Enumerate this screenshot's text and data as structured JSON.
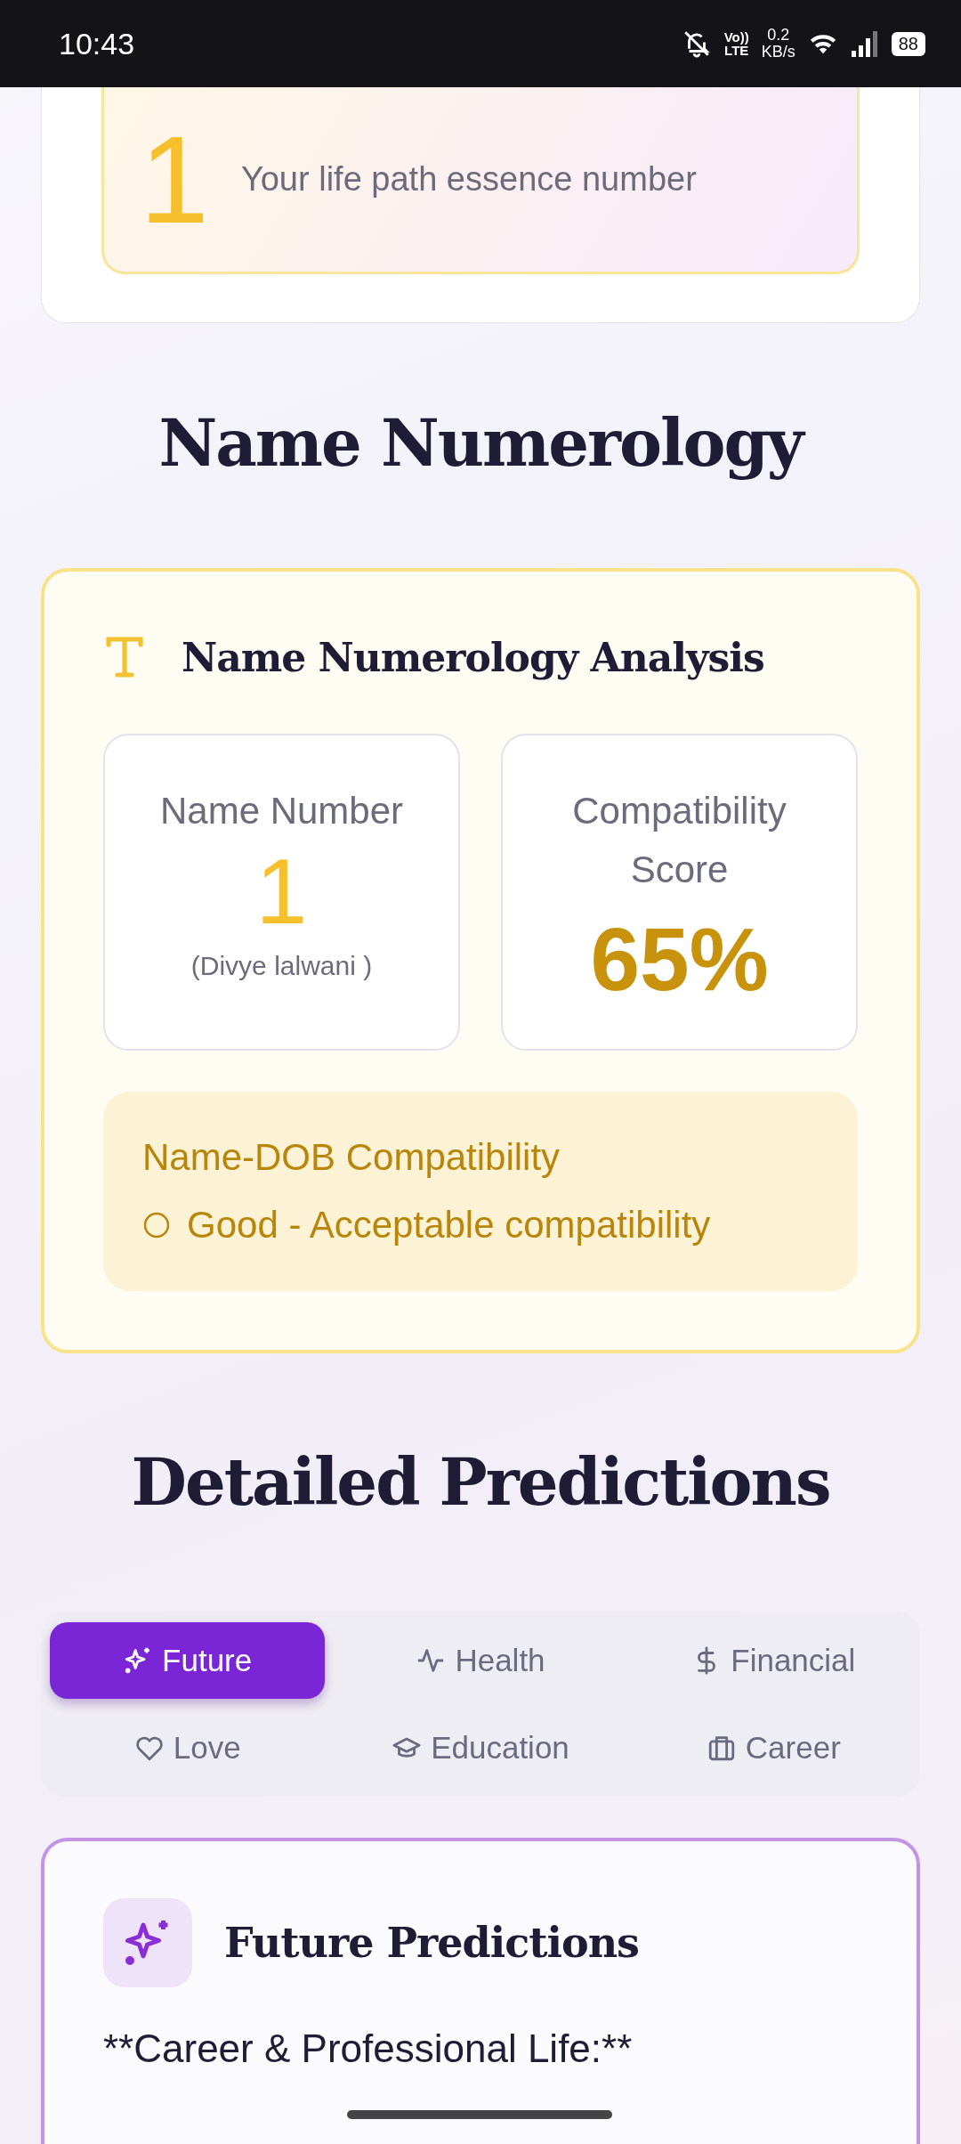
{
  "status_bar": {
    "time": "10:43",
    "network_speed": "0.2",
    "network_unit": "KB/s",
    "volte": "Vo))",
    "lte": "LTE",
    "battery": "88"
  },
  "essence_card": {
    "number": "1",
    "label": "Your life path essence number"
  },
  "name_section": {
    "heading": "Name Numerology",
    "card_title": "Name Numerology Analysis",
    "name_number": {
      "label": "Name Number",
      "value": "1",
      "name": "(Divye lalwani )"
    },
    "compatibility": {
      "label": "Compatibility Score",
      "value": "65%"
    },
    "dob_compat": {
      "title": "Name-DOB Compatibility",
      "text": "Good - Acceptable compatibility"
    }
  },
  "predictions": {
    "heading": "Detailed Predictions",
    "tabs": [
      {
        "label": "Future",
        "kind": "sparkle",
        "selected": true
      },
      {
        "label": "Health",
        "kind": "pulse",
        "selected": false
      },
      {
        "label": "Financial",
        "kind": "dollar",
        "selected": false
      },
      {
        "label": "Love",
        "kind": "heart",
        "selected": false
      },
      {
        "label": "Education",
        "kind": "cap",
        "selected": false
      },
      {
        "label": "Career",
        "kind": "briefcase",
        "selected": false
      }
    ],
    "card_title": "Future Predictions",
    "first_line": "**Career & Professional Life:**"
  }
}
